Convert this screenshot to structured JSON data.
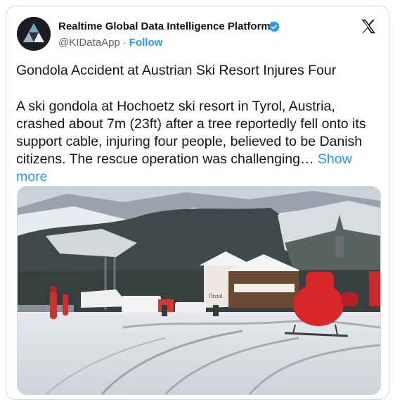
{
  "author": {
    "display_name": "Realtime Global Data Intelligence Platform",
    "handle": "@KIDataApp",
    "separator": "·",
    "follow_label": "Follow",
    "verified_icon": "verified-badge-icon",
    "avatar_icon": "triangle-logo-icon"
  },
  "platform_icon": "x-logo-icon",
  "tweet": {
    "headline": "Gondola Accident at Austrian Ski Resort Injures Four",
    "body": "A ski gondola at Hochoetz ski resort in Tyrol, Austria, crashed about 7m (23ft) after a tree reportedly fell onto its support cable, injuring four people, believed to be Danish citizens. The rescue operation was challenging…",
    "show_more": "Show more"
  },
  "media": {
    "sign_text": "Ötztal"
  },
  "colors": {
    "link": "#1d9bf0",
    "text": "#0f1419",
    "muted": "#536471",
    "border": "#cfd9de",
    "helicopter": "#d8272b"
  }
}
